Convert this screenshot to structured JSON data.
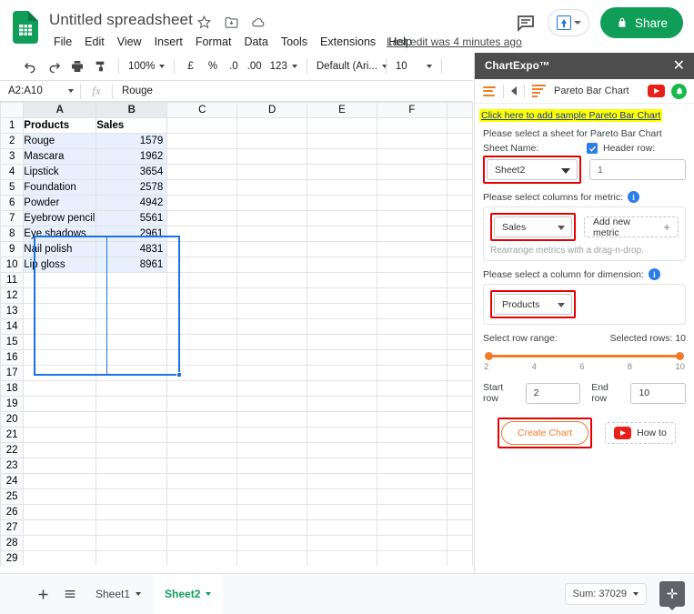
{
  "app": {
    "doc_title": "Untitled spreadsheet",
    "last_edit": "Last edit was 4 minutes ago",
    "share_label": "Share",
    "menus": [
      "File",
      "Edit",
      "View",
      "Insert",
      "Format",
      "Data",
      "Tools",
      "Extensions",
      "Help"
    ]
  },
  "toolbar": {
    "zoom": "100%",
    "currency": "£",
    "percent": "%",
    "dec_less": ".0",
    "dec_more": ".00",
    "formats": "123",
    "font": "Default (Ari...",
    "font_size": "10"
  },
  "formula_bar": {
    "name_box": "A2:A10",
    "fx": "fx",
    "value": "Rouge"
  },
  "grid": {
    "columns": [
      "A",
      "B",
      "C",
      "D",
      "E",
      "F"
    ],
    "selected_columns": [
      "A",
      "B"
    ],
    "header_row": [
      "Products",
      "Sales"
    ],
    "rows": [
      {
        "n": "2",
        "product": "Rouge",
        "sales": "1579"
      },
      {
        "n": "3",
        "product": "Mascara",
        "sales": "1962"
      },
      {
        "n": "4",
        "product": "Lipstick",
        "sales": "3654"
      },
      {
        "n": "5",
        "product": "Foundation",
        "sales": "2578"
      },
      {
        "n": "6",
        "product": "Powder",
        "sales": "4942"
      },
      {
        "n": "7",
        "product": "Eyebrow pencil",
        "sales": "5561"
      },
      {
        "n": "8",
        "product": "Eye shadows",
        "sales": "2961"
      },
      {
        "n": "9",
        "product": "Nail polish",
        "sales": "4831"
      },
      {
        "n": "10",
        "product": "Lip gloss",
        "sales": "8961"
      }
    ],
    "empty_rows": [
      "11",
      "12",
      "13",
      "14",
      "15",
      "16",
      "17",
      "18",
      "19",
      "20",
      "21",
      "22",
      "23",
      "24",
      "25",
      "26",
      "27",
      "28",
      "29"
    ]
  },
  "panel": {
    "title": "ChartExpo™",
    "close": "✕",
    "chart_name": "Pareto Bar Chart",
    "sample_link": "Click here to add sample Pareto Bar Chart",
    "sheet_prompt": "Please select a sheet for Pareto Bar Chart",
    "sheet_name_label": "Sheet Name:",
    "sheet_name_value": "Sheet2",
    "header_row_label": "Header row:",
    "header_row_value": "1",
    "metric_prompt": "Please select columns for metric:",
    "metric_value": "Sales",
    "add_metric_label": "Add new metric",
    "metric_hint": "Rearrange metrics with a drag-n-drop.",
    "dimension_prompt": "Please select a column for dimension:",
    "dimension_value": "Products",
    "range_label": "Select row range:",
    "selected_rows": "Selected rows: 10",
    "ticks": [
      "2",
      "4",
      "6",
      "8",
      "10"
    ],
    "start_row_label": "Start row",
    "start_row_value": "2",
    "end_row_label": "End row",
    "end_row_value": "10",
    "create_label": "Create Chart",
    "howto_label": "How to",
    "accent_color": "#f07c28",
    "highlight_color": "#e60000"
  },
  "bottom": {
    "sheets": [
      {
        "label": "Sheet1",
        "active": false
      },
      {
        "label": "Sheet2",
        "active": true
      }
    ],
    "sum": "Sum: 37029"
  }
}
